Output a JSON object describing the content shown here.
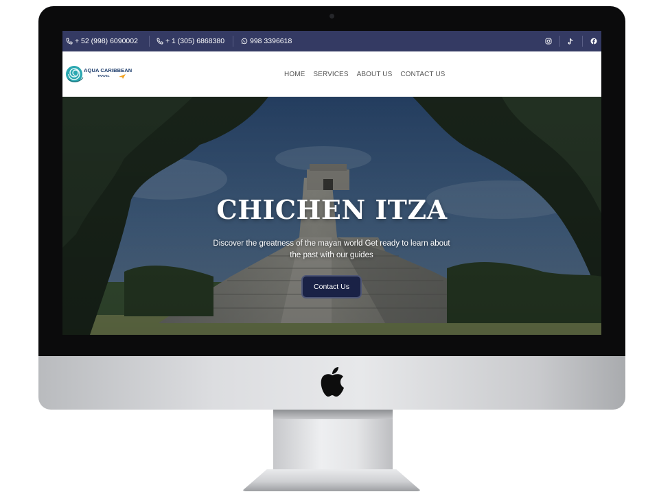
{
  "topbar": {
    "phones": [
      {
        "icon": "phone-icon",
        "text": "+ 52 (998) 6090002"
      },
      {
        "icon": "phone-icon",
        "text": "+ 1 (305) 6868380"
      },
      {
        "icon": "whatsapp-icon",
        "text": "998 3396618"
      }
    ],
    "social": [
      "instagram-icon",
      "tiktok-icon",
      "facebook-icon"
    ],
    "background": "#343a63"
  },
  "logo": {
    "line1": "AQUA CARIBBEAN",
    "line2": "TRAVEL"
  },
  "nav": {
    "items": [
      "HOME",
      "SERVICES",
      "ABOUT US",
      "CONTACT US"
    ]
  },
  "hero": {
    "title": "CHICHEN ITZA",
    "subtitle": "Discover the greatness of the mayan world Get ready to learn about the past with our guides",
    "button": "Contact Us",
    "button_color": "#1a2246"
  }
}
